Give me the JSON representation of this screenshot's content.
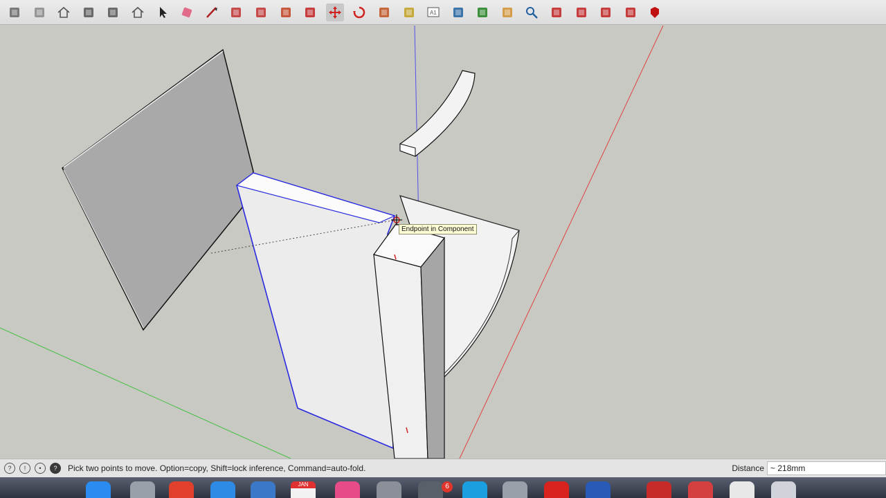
{
  "toolbar": {
    "tools": [
      {
        "name": "getting-started-icon",
        "color": "#666666"
      },
      {
        "name": "open-file-icon",
        "color": "#888888"
      },
      {
        "name": "home-icon",
        "color": "#555555"
      },
      {
        "name": "warehouse-icon",
        "color": "#555555"
      },
      {
        "name": "extension-warehouse-icon",
        "color": "#555555"
      },
      {
        "name": "house-outline-icon",
        "color": "#555555"
      },
      {
        "name": "select-arrow-icon",
        "color": "#222222"
      },
      {
        "name": "eraser-icon",
        "color": "#e26b8a"
      },
      {
        "name": "pencil-line-icon",
        "color": "#b02020"
      },
      {
        "name": "arc-icon",
        "color": "#c03030"
      },
      {
        "name": "rectangle-shape-icon",
        "color": "#c03030"
      },
      {
        "name": "push-pull-icon",
        "color": "#c04020"
      },
      {
        "name": "offset-icon",
        "color": "#c02020"
      },
      {
        "name": "move-icon",
        "color": "#d02020"
      },
      {
        "name": "rotate-icon",
        "color": "#d02020"
      },
      {
        "name": "scale-icon",
        "color": "#c05020"
      },
      {
        "name": "tape-measure-icon",
        "color": "#c0a020"
      },
      {
        "name": "text-icon",
        "color": "#555555"
      },
      {
        "name": "paint-bucket-icon",
        "color": "#2060a0"
      },
      {
        "name": "orbit-icon",
        "color": "#208020"
      },
      {
        "name": "pan-icon",
        "color": "#d09030"
      },
      {
        "name": "zoom-icon",
        "color": "#2060a0"
      },
      {
        "name": "zoom-extents-icon",
        "color": "#c02020"
      },
      {
        "name": "section-plane-icon",
        "color": "#c02020"
      },
      {
        "name": "layout-icon",
        "color": "#c02020"
      },
      {
        "name": "style-builder-icon",
        "color": "#c02020"
      },
      {
        "name": "ruby-icon",
        "color": "#c01010"
      }
    ],
    "active_tool": "move-icon"
  },
  "viewport": {
    "tooltip": "Endpoint in Component"
  },
  "statusbar": {
    "icons": [
      {
        "name": "geo-location-icon",
        "glyph": "?"
      },
      {
        "name": "credits-icon",
        "glyph": "!"
      },
      {
        "name": "user-icon",
        "glyph": "•"
      },
      {
        "name": "help-icon",
        "glyph": "?"
      }
    ],
    "message": "Pick two points to move.  Option=copy, Shift=lock inference, Command=auto-fold.",
    "measure_label": "Distance",
    "measure_value": "~ 218mm"
  },
  "dock": {
    "items": [
      {
        "name": "finder-icon",
        "color": "#2a8cf0"
      },
      {
        "name": "automator-icon",
        "color": "#9aa0aa"
      },
      {
        "name": "chrome-icon",
        "color": "#e0402c"
      },
      {
        "name": "safari-icon",
        "color": "#2f8ae6"
      },
      {
        "name": "preview-icon",
        "color": "#3c78c8"
      },
      {
        "name": "calendar-icon",
        "color": "#f2f2f2"
      },
      {
        "name": "itunes-icon",
        "color": "#e84c88"
      },
      {
        "name": "system-preferences-icon",
        "color": "#8a8f98"
      },
      {
        "name": "app-store-icon",
        "color": "#5a606a"
      },
      {
        "name": "skype-icon",
        "color": "#1aa0e0"
      },
      {
        "name": "automator-robot-icon",
        "color": "#9aa0aa"
      },
      {
        "name": "sketchup-icon",
        "color": "#d8231e"
      },
      {
        "name": "screen-recorder-icon",
        "color": "#2a5ab8"
      },
      {
        "name": "record-app-icon",
        "color": "#c82a2a"
      },
      {
        "name": "photo-booth-icon",
        "color": "#d44040"
      },
      {
        "name": "documents-icon",
        "color": "#e8e8e8"
      },
      {
        "name": "trash-icon",
        "color": "#d0d4da"
      }
    ],
    "calendar_month": "JAN",
    "badge": "6"
  }
}
